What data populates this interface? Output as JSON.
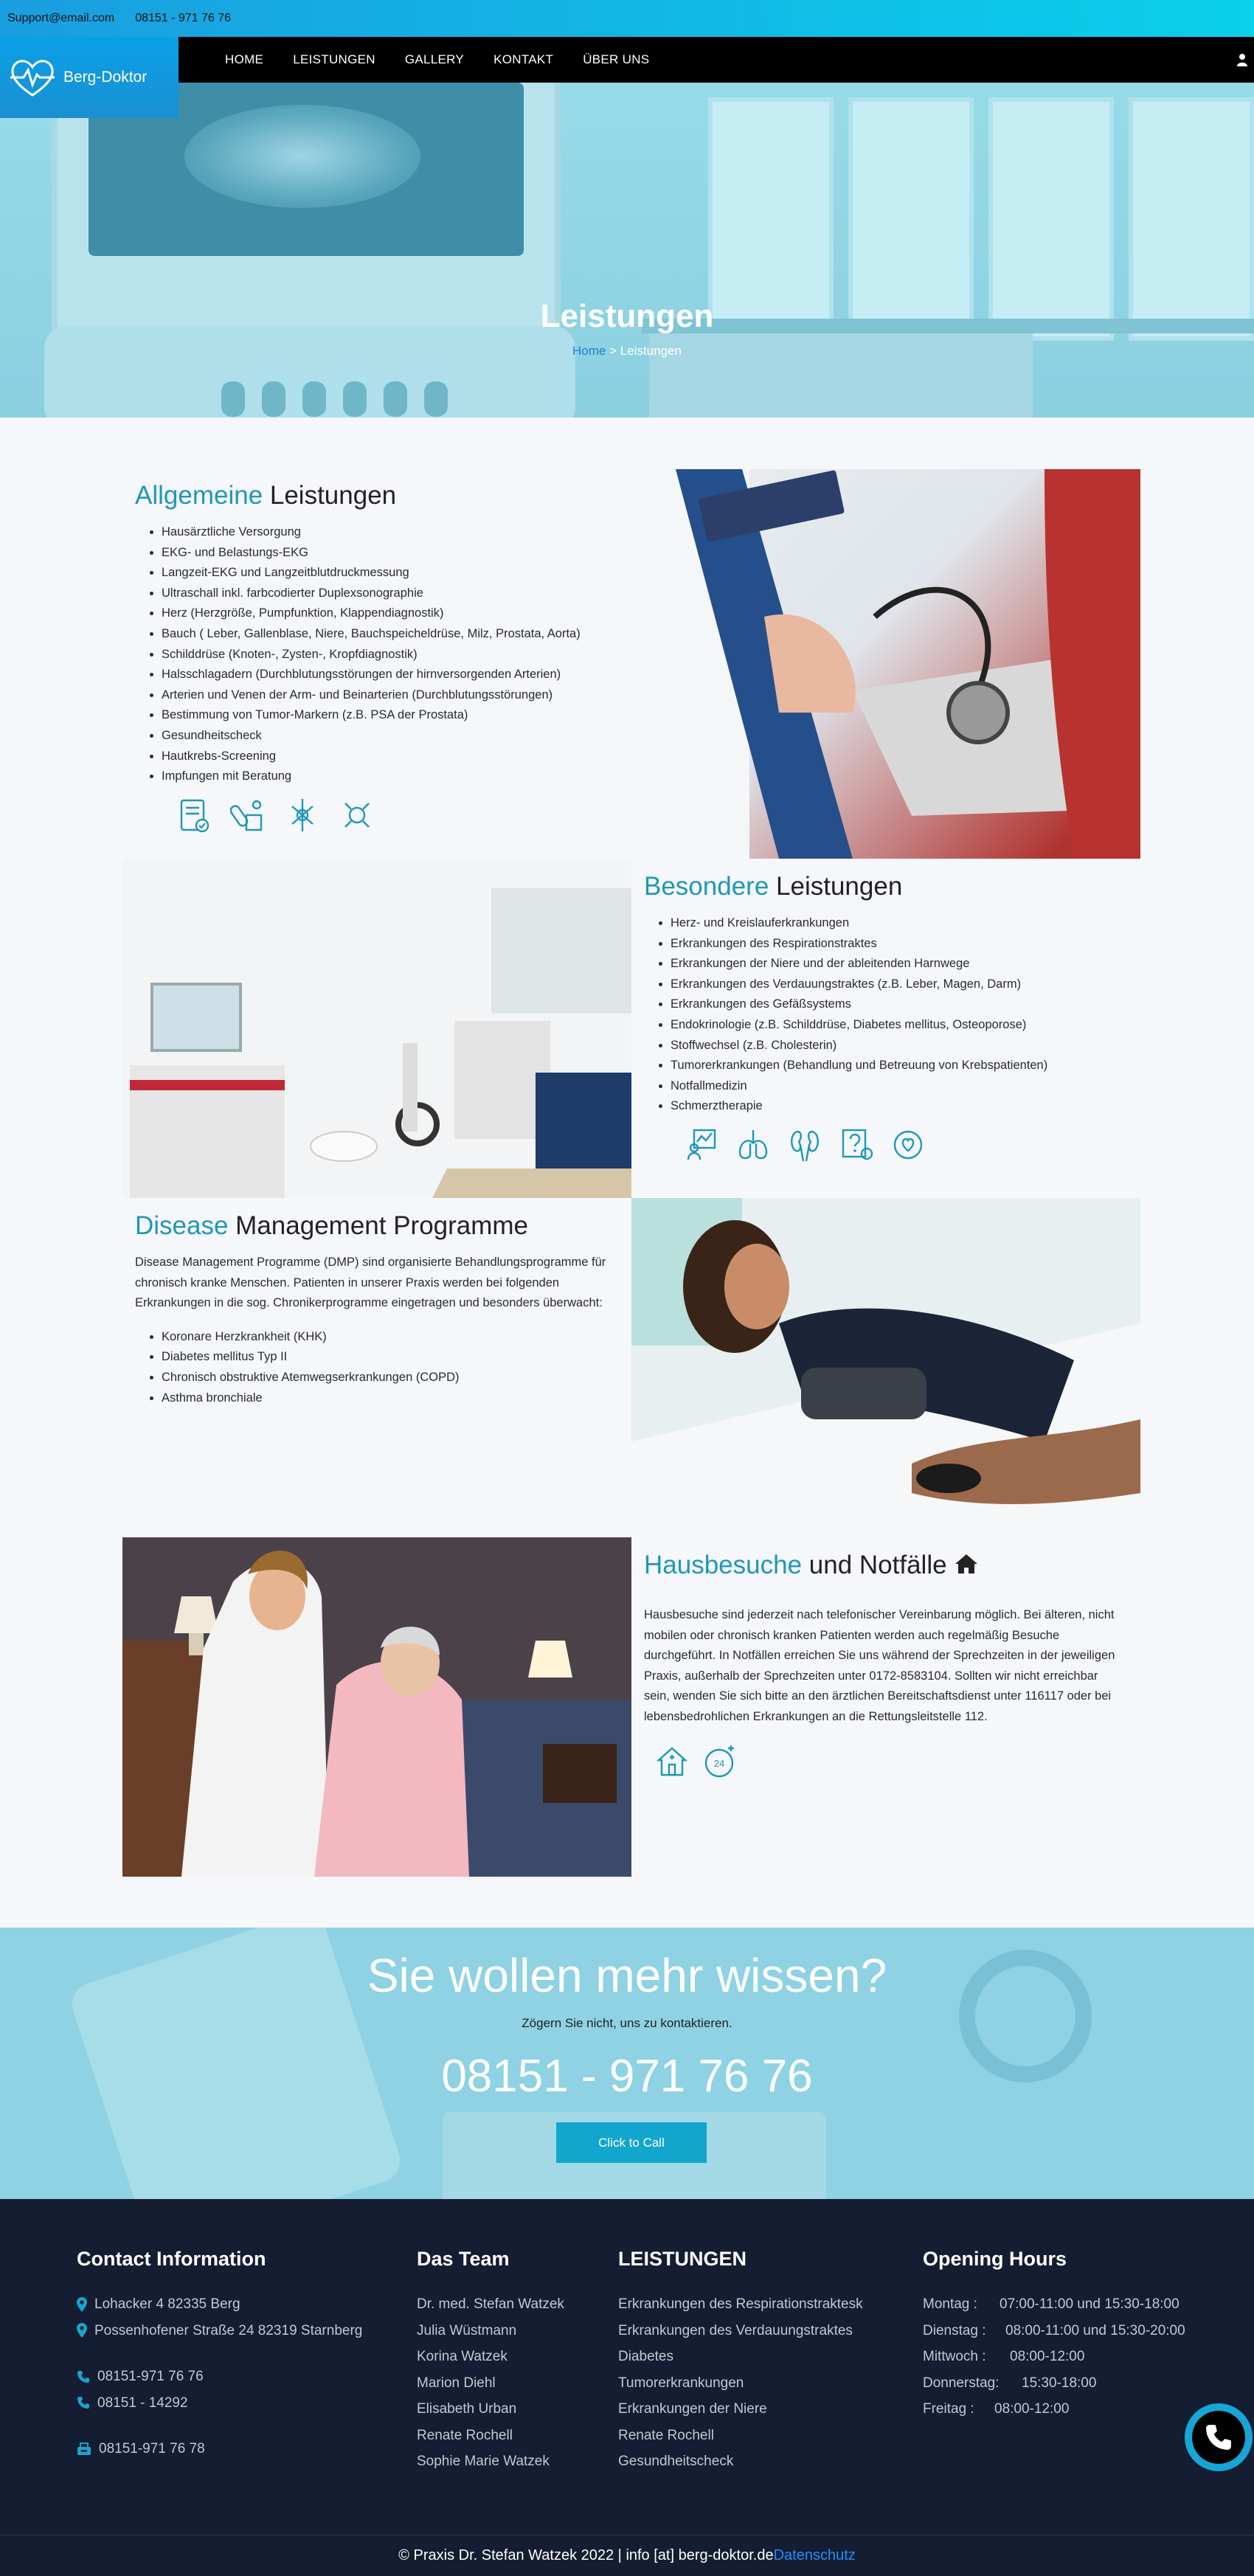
{
  "topbar": {
    "email": "Support@email.com",
    "phone": "08151 - 971 76 76"
  },
  "logo": {
    "text": "Berg-Doktor"
  },
  "nav": {
    "items": [
      "HOME",
      "LEISTUNGEN",
      "GALLERY",
      "KONTAKT",
      "ÜBER UNS"
    ]
  },
  "hero": {
    "title": "Leistungen",
    "breadcrumb_home": "Home",
    "breadcrumb_sep": " > ",
    "breadcrumb_current": "Leistungen"
  },
  "sections": {
    "allgemeine": {
      "accent": "Allgemeine",
      "rest": " Leistungen",
      "items": [
        "Hausärztliche Versorgung",
        "EKG- und Belastungs-EKG",
        "Langzeit-EKG und Langzeitblutdruckmessung",
        "Ultraschall inkl. farbcodierter Duplexsonographie",
        "Herz (Herzgröße, Pumpfunktion, Klappendiagnostik)",
        "Bauch ( Leber, Gallenblase, Niere, Bauchspeicheldrüse, Milz, Prostata, Aorta)",
        "Schilddrüse (Knoten-, Zysten-, Kropfdiagnostik)",
        "Halsschlagadern (Durchblutungsstörungen der hirnversorgenden Arterien)",
        "Arterien und Venen der Arm- und Beinarterien (Durchblutungsstörungen)",
        "Bestimmung von Tumor-Markern (z.B. PSA der Prostata)",
        "Gesundheitscheck",
        "Hautkrebs-Screening",
        "Impfungen mit Beratung"
      ],
      "icons": [
        "checklist-icon",
        "pills-icon",
        "cell-icon",
        "virus-icon"
      ]
    },
    "besondere": {
      "accent": "Besondere",
      "rest": " Leistungen",
      "items": [
        "Herz- und Kreislauferkrankungen",
        "Erkrankungen des Respirationstraktes",
        "Erkrankungen der Niere und der ableitenden Harnwege",
        "Erkrankungen des Verdauungstraktes (z.B. Leber, Magen, Darm)",
        "Erkrankungen des Gefäßsystems",
        "Endokrinologie (z.B. Schilddrüse, Diabetes mellitus, Osteoporose)",
        "Stoffwechsel (z.B. Cholesterin)",
        "Tumorerkrankungen (Behandlung und Betreuung von Krebspatienten)",
        "Notfallmedizin",
        "Schmerztherapie"
      ],
      "icons": [
        "heart-chart-icon",
        "lungs-icon",
        "kidneys-icon",
        "question-doctor-icon",
        "stethoscope-heart-icon"
      ]
    },
    "disease": {
      "accent": "Disease",
      "rest": " Management Programme",
      "intro": "Disease Management Programme (DMP) sind organisierte Behandlungsprogramme für chronisch kranke Menschen. Patienten in unserer Praxis werden bei folgenden Erkrankungen in die sog. Chronikerprogramme eingetragen und besonders überwacht:",
      "items": [
        "Koronare Herzkrankheit (KHK)",
        "Diabetes mellitus Typ II",
        "Chronisch obstruktive Atemwegserkrankungen (COPD)",
        "Asthma bronchiale"
      ]
    },
    "hausbesuche": {
      "accent": "Hausbesuche",
      "rest": " und Notfälle",
      "text": "Hausbesuche sind jederzeit nach telefonischer Vereinbarung möglich. Bei älteren, nicht mobilen oder chronisch kranken Patienten werden auch regelmäßig Besuche durchgeführt. In Notfällen erreichen Sie uns während der Sprechzeiten in der jeweiligen Praxis, außerhalb der Sprechzeiten unter 0172-8583104. Sollten wir nicht erreichbar sein, wenden Sie sich bitte an den ärztlichen Bereitschaftsdienst unter 116117 oder bei lebensbedrohlichen Erkrankungen an die Rettungsleitstelle 112.",
      "icons": [
        "house-visit-icon",
        "clock-24-icon"
      ]
    }
  },
  "cta": {
    "title": "Sie wollen mehr wissen?",
    "subtitle": "Zögern Sie nicht, uns zu kontaktieren.",
    "phone": "08151 - 971 76 76",
    "button": "Click to Call"
  },
  "footer": {
    "contact": {
      "heading": "Contact Information",
      "addresses": [
        "Lohacker 4 82335 Berg",
        "Possenhofener Straße 24 82319 Starnberg"
      ],
      "phones": [
        "08151-971 76 76",
        "08151 - 14292"
      ],
      "fax": "08151-971 76 78"
    },
    "team": {
      "heading": "Das Team",
      "members": [
        "Dr. med. Stefan Watzek",
        "Julia Wüstmann",
        "Korina Watzek",
        "Marion Diehl",
        "Elisabeth Urban",
        "Renate Rochell",
        "Sophie Marie Watzek"
      ]
    },
    "leistungen": {
      "heading": "LEISTUNGEN",
      "links": [
        "Erkrankungen des Respirationstraktesk",
        "Erkrankungen des Verdauungstraktes",
        "Diabetes",
        "Tumorerkrankungen",
        "Erkrankungen der Niere",
        "Renate Rochell",
        "Gesundheitscheck"
      ]
    },
    "hours": {
      "heading": "Opening Hours",
      "rows": [
        {
          "day": "Montag :",
          "time": "07:00-11:00 und 15:30-18:00"
        },
        {
          "day": "Dienstag :",
          "time": "08:00-11:00 und 15:30-20:00"
        },
        {
          "day": "Mittwoch :",
          "time": "08:00-12:00"
        },
        {
          "day": "Donnerstag:",
          "time": "15:30-18:00"
        },
        {
          "day": "Freitag :",
          "time": "08:00-12:00"
        }
      ]
    },
    "copyright": "© Praxis Dr. Stefan Watzek 2022 | info [at] berg-doktor.de",
    "privacy": "Datenschutz"
  },
  "colors": {
    "accent": "#1f97b8",
    "footer_bg": "#141d31",
    "button": "#13a6cc"
  }
}
